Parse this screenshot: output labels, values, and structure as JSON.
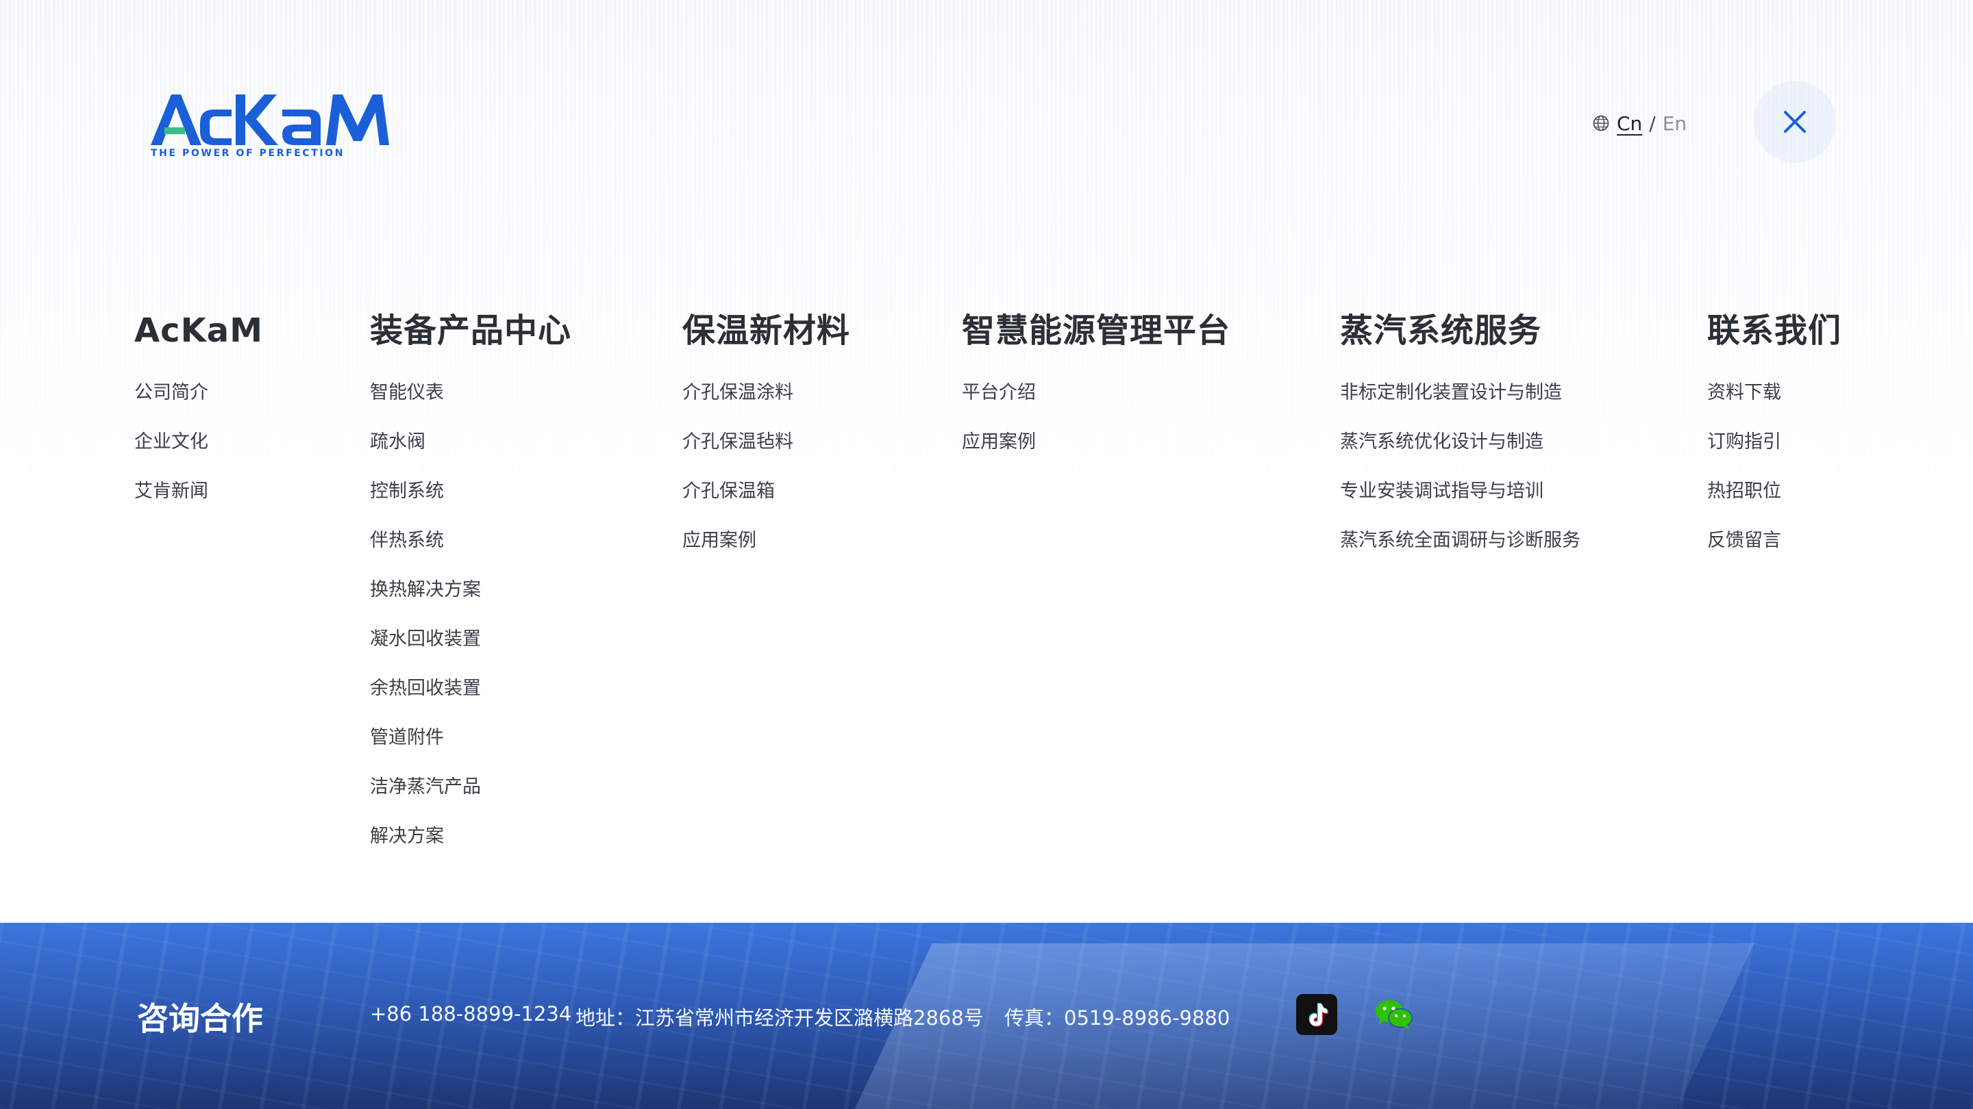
{
  "header": {
    "logo_text": "AcKaM",
    "logo_tagline": "THE POWER OF PERFECTION",
    "lang_cn": "Cn",
    "lang_sep": "/",
    "lang_en": "En",
    "colors": {
      "brand_blue": "#1a5fd8",
      "dark_text": "#2b2f36",
      "close_icon": "#1a5fd8"
    }
  },
  "menu": [
    {
      "title": "AcKaM",
      "items": [
        "公司简介",
        "企业文化",
        "艾肯新闻"
      ]
    },
    {
      "title": "装备产品中心",
      "items": [
        "智能仪表",
        "疏水阀",
        "控制系统",
        "伴热系统",
        "换热解决方案",
        "凝水回收装置",
        "余热回收装置",
        "管道附件",
        "洁净蒸汽产品",
        "解决方案"
      ]
    },
    {
      "title": "保温新材料",
      "items": [
        "介孔保温涂料",
        "介孔保温毡料",
        "介孔保温箱",
        "应用案例"
      ]
    },
    {
      "title": "智慧能源管理平台",
      "items": [
        "平台介绍",
        "应用案例"
      ]
    },
    {
      "title": "蒸汽系统服务",
      "items": [
        "非标定制化装置设计与制造",
        "蒸汽系统优化设计与制造",
        "专业安装调试指导与培训",
        "蒸汽系统全面调研与诊断服务"
      ]
    },
    {
      "title": "联系我们",
      "items": [
        "资料下载",
        "订购指引",
        "热招职位",
        "反馈留言"
      ]
    }
  ],
  "footer": {
    "title": "咨询合作",
    "phone": "+86 188-8899-1234",
    "address": "地址：江苏省常州市经济开发区潞横路2868号",
    "fax": "传真：0519-8986-9880",
    "icons": [
      "tiktok-icon",
      "wechat-icon"
    ]
  }
}
